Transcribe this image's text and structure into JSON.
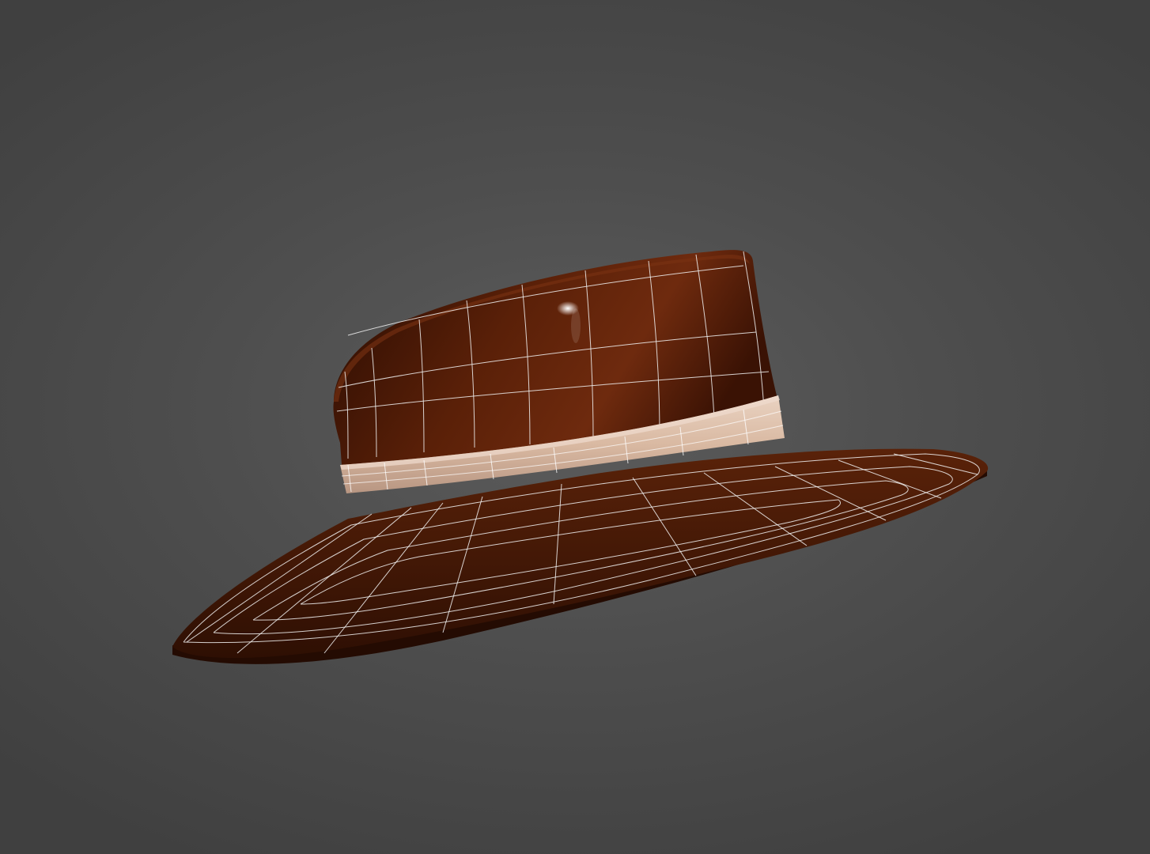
{
  "viewport": {
    "background_color": "#4e4e4e"
  },
  "model": {
    "colors": {
      "crown": "#4a1a06",
      "crown_light": "#6e2a0e",
      "crown_dark": "#2a0c02",
      "brim": "#4e1d08",
      "brim_dark": "#2e0f03",
      "band": "#d9b9a2",
      "band_light": "#ead3c2",
      "band_dark": "#b89682",
      "wireframe": "#f2f2f2",
      "specular": "#ffffff"
    }
  }
}
